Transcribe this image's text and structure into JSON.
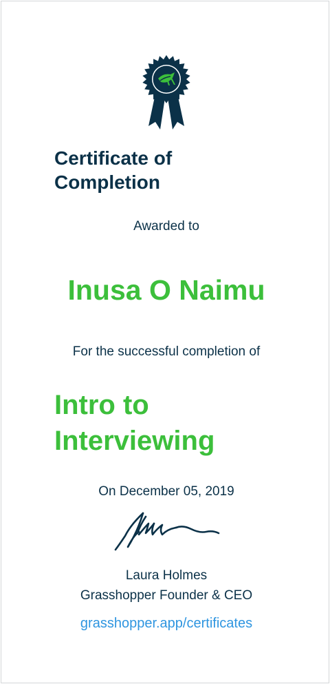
{
  "certificate": {
    "badge_icon": "grasshopper-ribbon-award-icon",
    "title_line1": "Certificate of",
    "title_line2": "Completion",
    "awarded_to_label": "Awarded to",
    "recipient_name": "Inusa O Naimu",
    "completion_label": "For the successful completion of",
    "course_line1": "Intro to",
    "course_line2": "Interviewing",
    "date_text": "On December 05, 2019",
    "signature_icon": "handwritten-signature",
    "signer_name": "Laura Holmes",
    "signer_title": "Grasshopper Founder & CEO",
    "link_text": "grasshopper.app/certificates"
  },
  "colors": {
    "navy": "#0b3148",
    "green": "#3cbf3b",
    "link_blue": "#2e95e0",
    "border": "#d4d6d8"
  }
}
